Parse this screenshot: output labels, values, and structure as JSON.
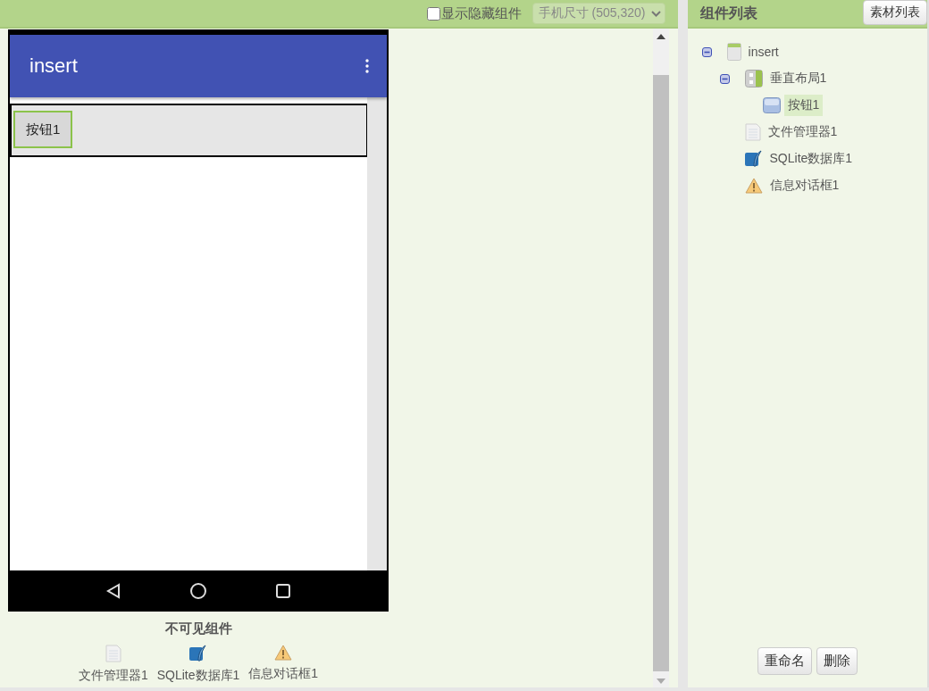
{
  "toolbar": {
    "show_hidden": {
      "label": "显示隐藏组件",
      "checked": false
    },
    "screen_size": "手机尺寸 (505,320)"
  },
  "phone": {
    "title": "insert",
    "components": [
      {
        "kind": "vertical_arrangement",
        "children": [
          {
            "kind": "button",
            "label": "按钮1",
            "selected": true
          }
        ]
      }
    ]
  },
  "non_visible": {
    "heading": "不可见组件",
    "items": [
      {
        "kind": "file",
        "label": "文件管理器1"
      },
      {
        "kind": "database",
        "label": "SQLite数据库1"
      },
      {
        "kind": "notifier",
        "label": "信息对话框1"
      }
    ]
  },
  "components_panel": {
    "title": "组件列表",
    "assets_button": "素材列表",
    "tree": [
      {
        "kind": "screen",
        "label": "insert",
        "expanded": true,
        "selected": false,
        "children": [
          {
            "kind": "vertical_arrangement",
            "label": "垂直布局1",
            "expanded": true,
            "selected": false,
            "children": [
              {
                "kind": "button",
                "label": "按钮1",
                "selected": true
              }
            ]
          },
          {
            "kind": "file",
            "label": "文件管理器1",
            "selected": false
          },
          {
            "kind": "database",
            "label": "SQLite数据库1",
            "selected": false
          },
          {
            "kind": "notifier",
            "label": "信息对话框1",
            "selected": false
          }
        ]
      }
    ],
    "buttons": [
      "重命名",
      "删除"
    ]
  }
}
